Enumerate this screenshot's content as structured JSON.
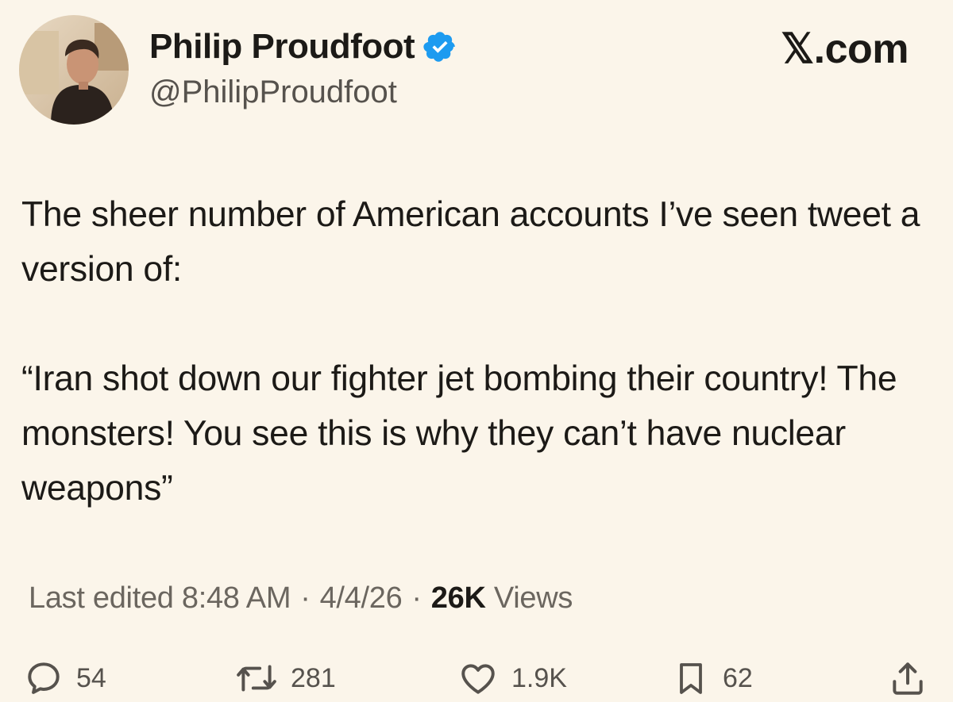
{
  "author": {
    "display_name": "Philip Proudfoot",
    "handle": "@PhilipProudfoot",
    "verified": true,
    "avatar_icon": "profile-photo"
  },
  "site_mark": "𝕏.com",
  "tweet": {
    "paragraphs": [
      "The sheer number of American accounts I’ve seen tweet a version of:",
      "“Iran shot down our fighter jet bombing their country! The monsters! You see this is why they can’t have nuclear weapons”"
    ]
  },
  "meta": {
    "edited_label": "Last edited 8:48 AM",
    "date": "4/4/26",
    "separator": "·",
    "views_count": "26K",
    "views_label": "Views"
  },
  "actions": {
    "replies": {
      "icon": "reply-icon",
      "count": "54"
    },
    "reposts": {
      "icon": "repost-icon",
      "count": "281"
    },
    "likes": {
      "icon": "heart-icon",
      "count": "1.9K"
    },
    "bookmarks": {
      "icon": "bookmark-icon",
      "count": "62"
    },
    "share": {
      "icon": "share-icon"
    }
  },
  "colors": {
    "background": "#fbf5ea",
    "text": "#1c1a17",
    "muted": "#6b665f",
    "verified": "#1d9bf0"
  }
}
